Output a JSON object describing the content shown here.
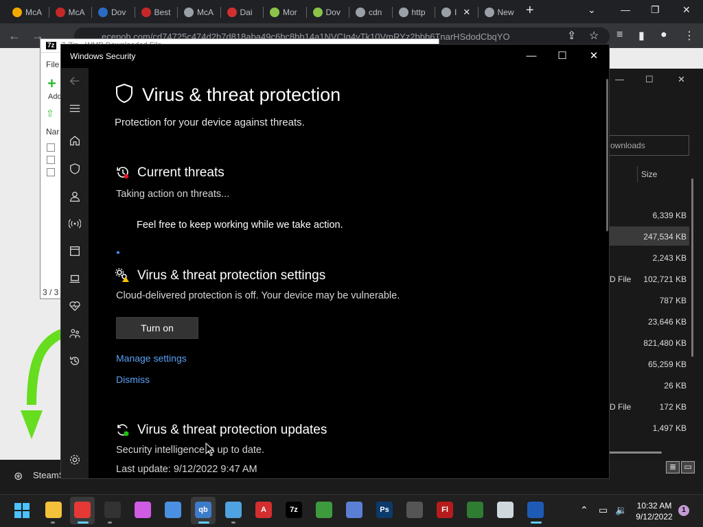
{
  "browser": {
    "tabs": [
      {
        "label": "McA",
        "color": "#f2a900"
      },
      {
        "label": "McA",
        "color": "#c62828"
      },
      {
        "label": "Dov",
        "color": "#2a6cc4"
      },
      {
        "label": "Best",
        "color": "#c62828"
      },
      {
        "label": "McA",
        "color": "#9aa0a6"
      },
      {
        "label": "Dai",
        "color": "#d32f2f"
      },
      {
        "label": "Mor",
        "color": "#8bc34a"
      },
      {
        "label": "Dov",
        "color": "#8bc34a"
      },
      {
        "label": "cdn",
        "color": "#9aa0a6"
      },
      {
        "label": "http",
        "color": "#9aa0a6"
      },
      {
        "label": "I",
        "color": "#9aa0a6"
      },
      {
        "label": "New",
        "color": "#9aa0a6"
      }
    ],
    "new_tab": "+",
    "url": "ecepob.com/cd74725c474d2b7d818aba49c6bc8bb14a1NVCIg4vTk10VmRYz2bbb6TnarHSdodCbqYO"
  },
  "sevenzip": {
    "title": "7-Zip - WMP Downloaded File...",
    "menu": "File",
    "add_label": "Add",
    "col_name": "Nar",
    "status": "3 / 3"
  },
  "downloads": {
    "search_placeholder": "ownloads",
    "size_header": "Size",
    "rows": [
      {
        "type": "",
        "size": "6,339 KB"
      },
      {
        "type": "",
        "size": "247,534 KB"
      },
      {
        "type": "",
        "size": "2,243 KB"
      },
      {
        "type": "D File",
        "size": "102,721 KB"
      },
      {
        "type": "",
        "size": "787 KB"
      },
      {
        "type": "",
        "size": "23,646 KB"
      },
      {
        "type": "",
        "size": "821,480 KB"
      },
      {
        "type": "",
        "size": "65,259 KB"
      },
      {
        "type": "",
        "size": "26 KB"
      },
      {
        "type": "D File",
        "size": "172 KB"
      },
      {
        "type": "",
        "size": "1,497 KB"
      }
    ]
  },
  "steam": {
    "label": "SteamS"
  },
  "security": {
    "window_title": "Windows Security",
    "page_title": "Virus & threat protection",
    "subtitle": "Protection for your device against threats.",
    "current_threats": {
      "title": "Current threats",
      "status": "Taking action on threats...",
      "message": "Feel free to keep working while we take action."
    },
    "settings": {
      "title": "Virus & threat protection settings",
      "status": "Cloud-delivered protection is off. Your device may be vulnerable.",
      "turn_on": "Turn on",
      "manage": "Manage settings",
      "dismiss": "Dismiss"
    },
    "updates": {
      "title": "Virus & threat protection updates",
      "status": "Security intelligence is up to date.",
      "last_update": "Last update: 9/12/2022 9:47 AM"
    },
    "nav_icons": [
      "back-arrow-icon",
      "hamburger-menu-icon",
      "home-icon",
      "shield-icon",
      "account-icon",
      "network-icon",
      "app-browser-icon",
      "device-security-icon",
      "health-heart-icon",
      "family-icon",
      "history-icon",
      "settings-gear-icon"
    ]
  },
  "taskbar": {
    "time": "10:32 AM",
    "date": "9/12/2022",
    "notification_count": "1",
    "accent": "#60cdff"
  }
}
